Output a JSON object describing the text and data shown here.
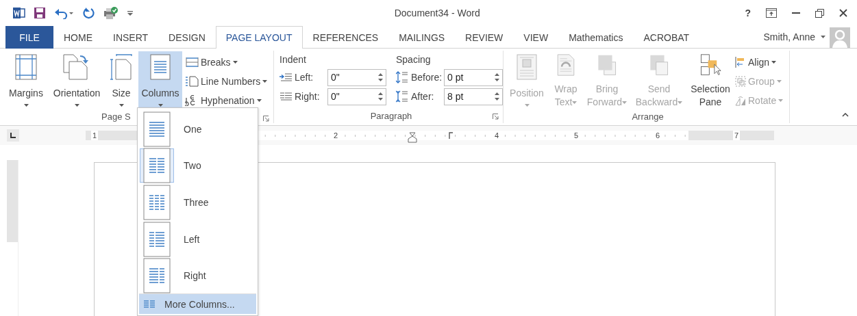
{
  "window": {
    "title": "Document34 - Word",
    "help": "?"
  },
  "tabs": [
    {
      "label": "FILE",
      "kind": "file",
      "selected": false
    },
    {
      "label": "HOME",
      "kind": "tab",
      "selected": false
    },
    {
      "label": "INSERT",
      "kind": "tab",
      "selected": false
    },
    {
      "label": "DESIGN",
      "kind": "tab",
      "selected": false
    },
    {
      "label": "PAGE LAYOUT",
      "kind": "tab",
      "selected": true
    },
    {
      "label": "REFERENCES",
      "kind": "tab",
      "selected": false
    },
    {
      "label": "MAILINGS",
      "kind": "tab",
      "selected": false
    },
    {
      "label": "REVIEW",
      "kind": "tab",
      "selected": false
    },
    {
      "label": "VIEW",
      "kind": "tab",
      "selected": false
    },
    {
      "label": "Mathematics",
      "kind": "tab",
      "selected": false
    },
    {
      "label": "ACROBAT",
      "kind": "tab",
      "selected": false
    }
  ],
  "account": {
    "name": "Smith, Anne"
  },
  "page_setup": {
    "label": "Page S",
    "large_buttons": [
      {
        "lines": [
          "Margins"
        ],
        "dropdown": true,
        "selected": false
      },
      {
        "lines": [
          "Orientation"
        ],
        "dropdown": true,
        "selected": false
      },
      {
        "lines": [
          "Size"
        ],
        "dropdown": true,
        "selected": false
      },
      {
        "lines": [
          "Columns"
        ],
        "dropdown": true,
        "selected": true
      }
    ],
    "small_buttons": [
      {
        "label": "Breaks",
        "dropdown": true
      },
      {
        "label": "Line Numbers",
        "dropdown": true
      },
      {
        "label": "Hyphenation",
        "dropdown": true
      }
    ]
  },
  "paragraph": {
    "label": "Paragraph",
    "indent_label": "Indent",
    "spacing_label": "Spacing",
    "indent": [
      {
        "label": "Left:",
        "value": "0\""
      },
      {
        "label": "Right:",
        "value": "0\""
      }
    ],
    "spacing": [
      {
        "label": "Before:",
        "value": "0 pt"
      },
      {
        "label": "After:",
        "value": "8 pt"
      }
    ]
  },
  "arrange": {
    "label": "Arrange",
    "large_buttons": [
      {
        "lines": [
          "Position"
        ],
        "dropdown": true,
        "disabled": true
      },
      {
        "lines": [
          "Wrap",
          "Text"
        ],
        "dropdown": true,
        "disabled": true
      },
      {
        "lines": [
          "Bring",
          "Forward"
        ],
        "dropdown": true,
        "disabled": true
      },
      {
        "lines": [
          "Send",
          "Backward"
        ],
        "dropdown": true,
        "disabled": true
      },
      {
        "lines": [
          "Selection",
          "Pane"
        ],
        "dropdown": false,
        "disabled": false
      }
    ],
    "small_buttons": [
      {
        "label": "Align",
        "dropdown": true,
        "disabled": false
      },
      {
        "label": "Group",
        "dropdown": true,
        "disabled": true
      },
      {
        "label": "Rotate",
        "dropdown": true,
        "disabled": true
      }
    ]
  },
  "ruler": {
    "numbers": [
      "1",
      "2",
      "4",
      "5",
      "6",
      "7"
    ]
  },
  "columns_menu": {
    "items": [
      {
        "label": "One",
        "selected": false
      },
      {
        "label": "Two",
        "selected": true
      },
      {
        "label": "Three",
        "selected": false
      },
      {
        "label": "Left",
        "selected": false
      },
      {
        "label": "Right",
        "selected": false
      }
    ],
    "more": {
      "label": "More Columns...",
      "hovered": true
    }
  }
}
